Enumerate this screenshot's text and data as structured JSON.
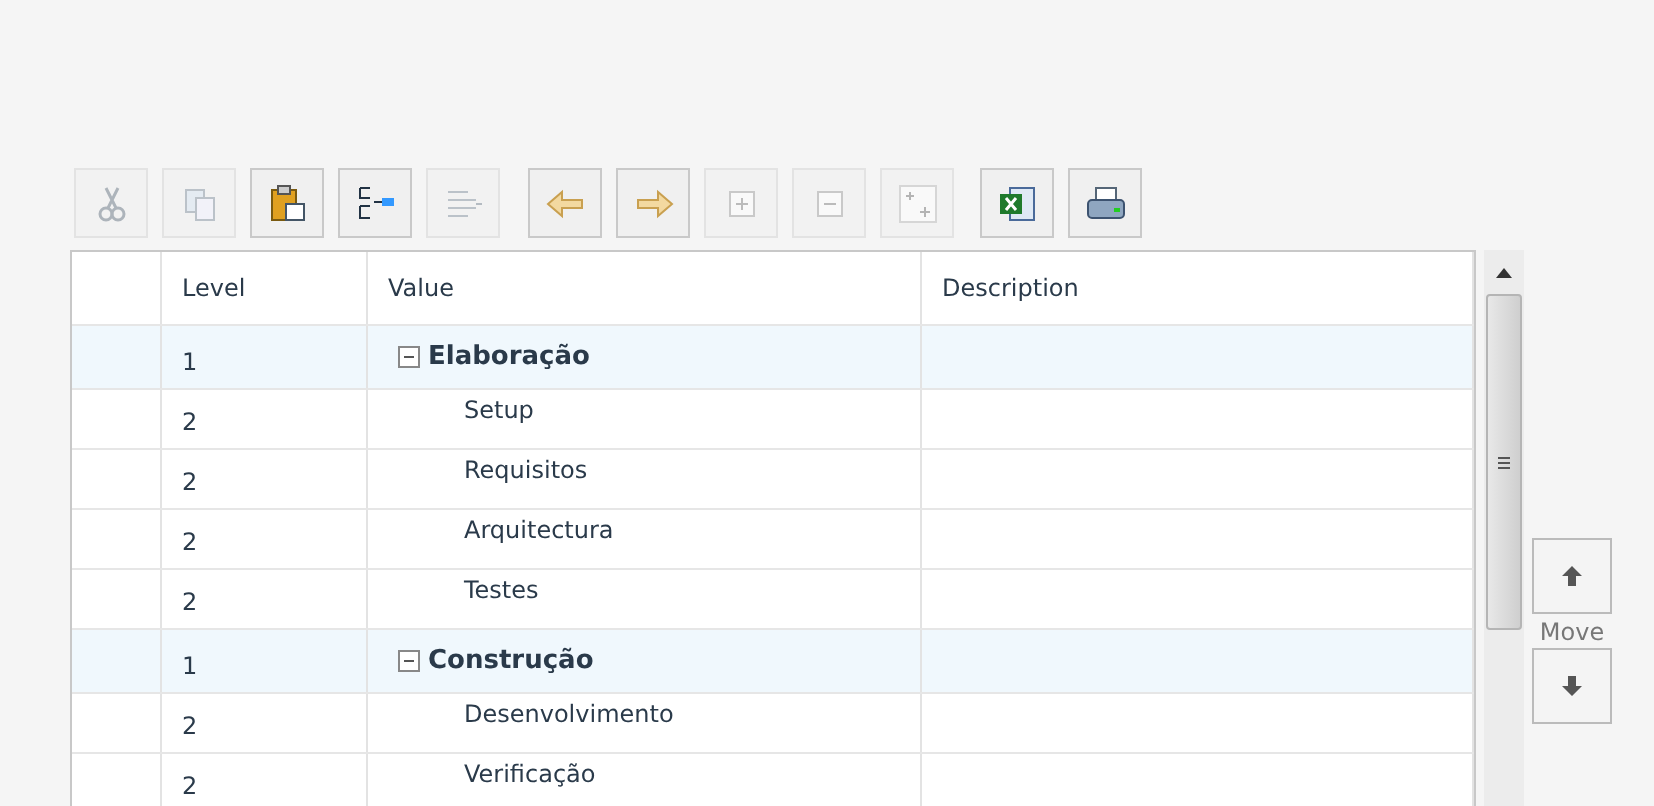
{
  "toolbar": [
    {
      "kind": "cut",
      "disabled": true
    },
    {
      "kind": "copy",
      "disabled": true
    },
    {
      "kind": "paste",
      "disabled": false
    },
    {
      "kind": "outdent",
      "disabled": false
    },
    {
      "kind": "indent",
      "disabled": true
    },
    {
      "kind": "left",
      "disabled": false
    },
    {
      "kind": "right",
      "disabled": false
    },
    {
      "kind": "expand",
      "disabled": true
    },
    {
      "kind": "collapse",
      "disabled": true
    },
    {
      "kind": "add",
      "disabled": true
    },
    {
      "kind": "excel",
      "disabled": false
    },
    {
      "kind": "print",
      "disabled": false
    }
  ],
  "table": {
    "columns": [
      "Level",
      "Value",
      "Description"
    ],
    "rows": [
      {
        "level": "1",
        "value": "Elaboração",
        "expanded": true,
        "children": [
          {
            "level": "2",
            "value": "Setup"
          },
          {
            "level": "2",
            "value": "Requisitos"
          },
          {
            "level": "2",
            "value": "Arquitectura"
          },
          {
            "level": "2",
            "value": "Testes"
          }
        ]
      },
      {
        "level": "1",
        "value": "Construção",
        "expanded": true,
        "children": [
          {
            "level": "2",
            "value": "Desenvolvimento"
          },
          {
            "level": "2",
            "value": "Verificação"
          }
        ]
      }
    ]
  },
  "move": {
    "label": "Move"
  }
}
